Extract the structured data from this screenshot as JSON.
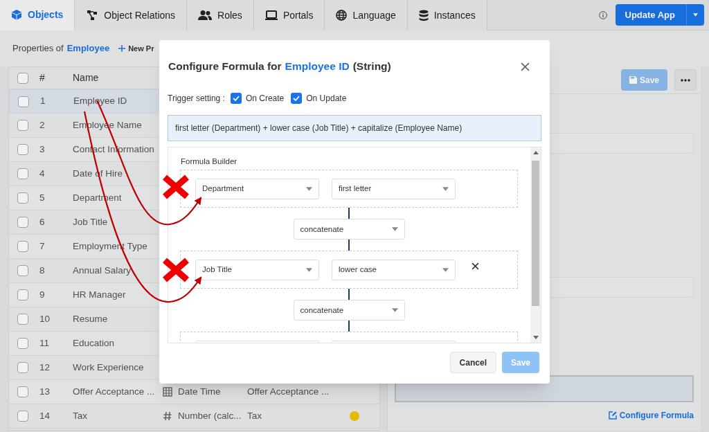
{
  "tabs": [
    {
      "label": "Objects",
      "selected": true
    },
    {
      "label": "Object Relations",
      "selected": false
    },
    {
      "label": "Roles",
      "selected": false
    },
    {
      "label": "Portals",
      "selected": false
    },
    {
      "label": "Language",
      "selected": false
    },
    {
      "label": "Instances",
      "selected": false
    }
  ],
  "update_button": "Update App",
  "toolbar": {
    "label": "Properties of",
    "object": "Employee",
    "new_button": "New Pr"
  },
  "table": {
    "select_all_checked": false,
    "columns": [
      "#",
      "Name"
    ],
    "rows": [
      {
        "number": "1",
        "name": "Employee ID",
        "selected": true
      },
      {
        "number": "2",
        "name": "Employee Name",
        "selected": false
      },
      {
        "number": "3",
        "name": "Contact Information",
        "selected": false
      },
      {
        "number": "4",
        "name": "Date of Hire",
        "selected": false
      },
      {
        "number": "5",
        "name": "Department",
        "selected": false
      },
      {
        "number": "6",
        "name": "Job Title",
        "selected": false
      },
      {
        "number": "7",
        "name": "Employment Type",
        "selected": false
      },
      {
        "number": "8",
        "name": "Annual Salary",
        "selected": false
      },
      {
        "number": "9",
        "name": "HR Manager",
        "selected": false
      },
      {
        "number": "10",
        "name": "Resume",
        "selected": false
      },
      {
        "number": "11",
        "name": "Education",
        "selected": false
      },
      {
        "number": "12",
        "name": "Work Experience",
        "selected": false
      },
      {
        "number": "13",
        "name": "Offer Acceptance ...",
        "selected": false,
        "kind": "datetime",
        "type": "Date Time",
        "column_4": "Offer Acceptance ..."
      },
      {
        "number": "14",
        "name": "Tax",
        "selected": false,
        "kind": "number",
        "type": "Number (calc...",
        "column_4": "Tax",
        "color": "#f2c500"
      }
    ]
  },
  "detail_panel": {
    "save_button": "Save",
    "configure_link": "Configure Formula"
  },
  "dialog": {
    "title_prefix": "Configure Formula for",
    "title_subject": "Employee ID",
    "title_suffix": "(String)",
    "trigger_label": "Trigger setting :",
    "triggers": [
      {
        "label": "On Create",
        "checked": true
      },
      {
        "label": "On Update",
        "checked": true
      }
    ],
    "expression": "first letter (Department) + lower case (Job Title) + capitalize (Employee Name)",
    "builder": {
      "title": "Formula Builder",
      "steps": [
        {
          "kind": "term",
          "field": "Department",
          "function": "first letter",
          "removable": false
        },
        {
          "kind": "operator",
          "value": "concatenate"
        },
        {
          "kind": "term",
          "field": "Job Title",
          "function": "lower case",
          "removable": true
        },
        {
          "kind": "operator",
          "value": "concatenate"
        },
        {
          "kind": "term"
        }
      ]
    },
    "cancel_button": "Cancel",
    "save_button": "Save"
  }
}
